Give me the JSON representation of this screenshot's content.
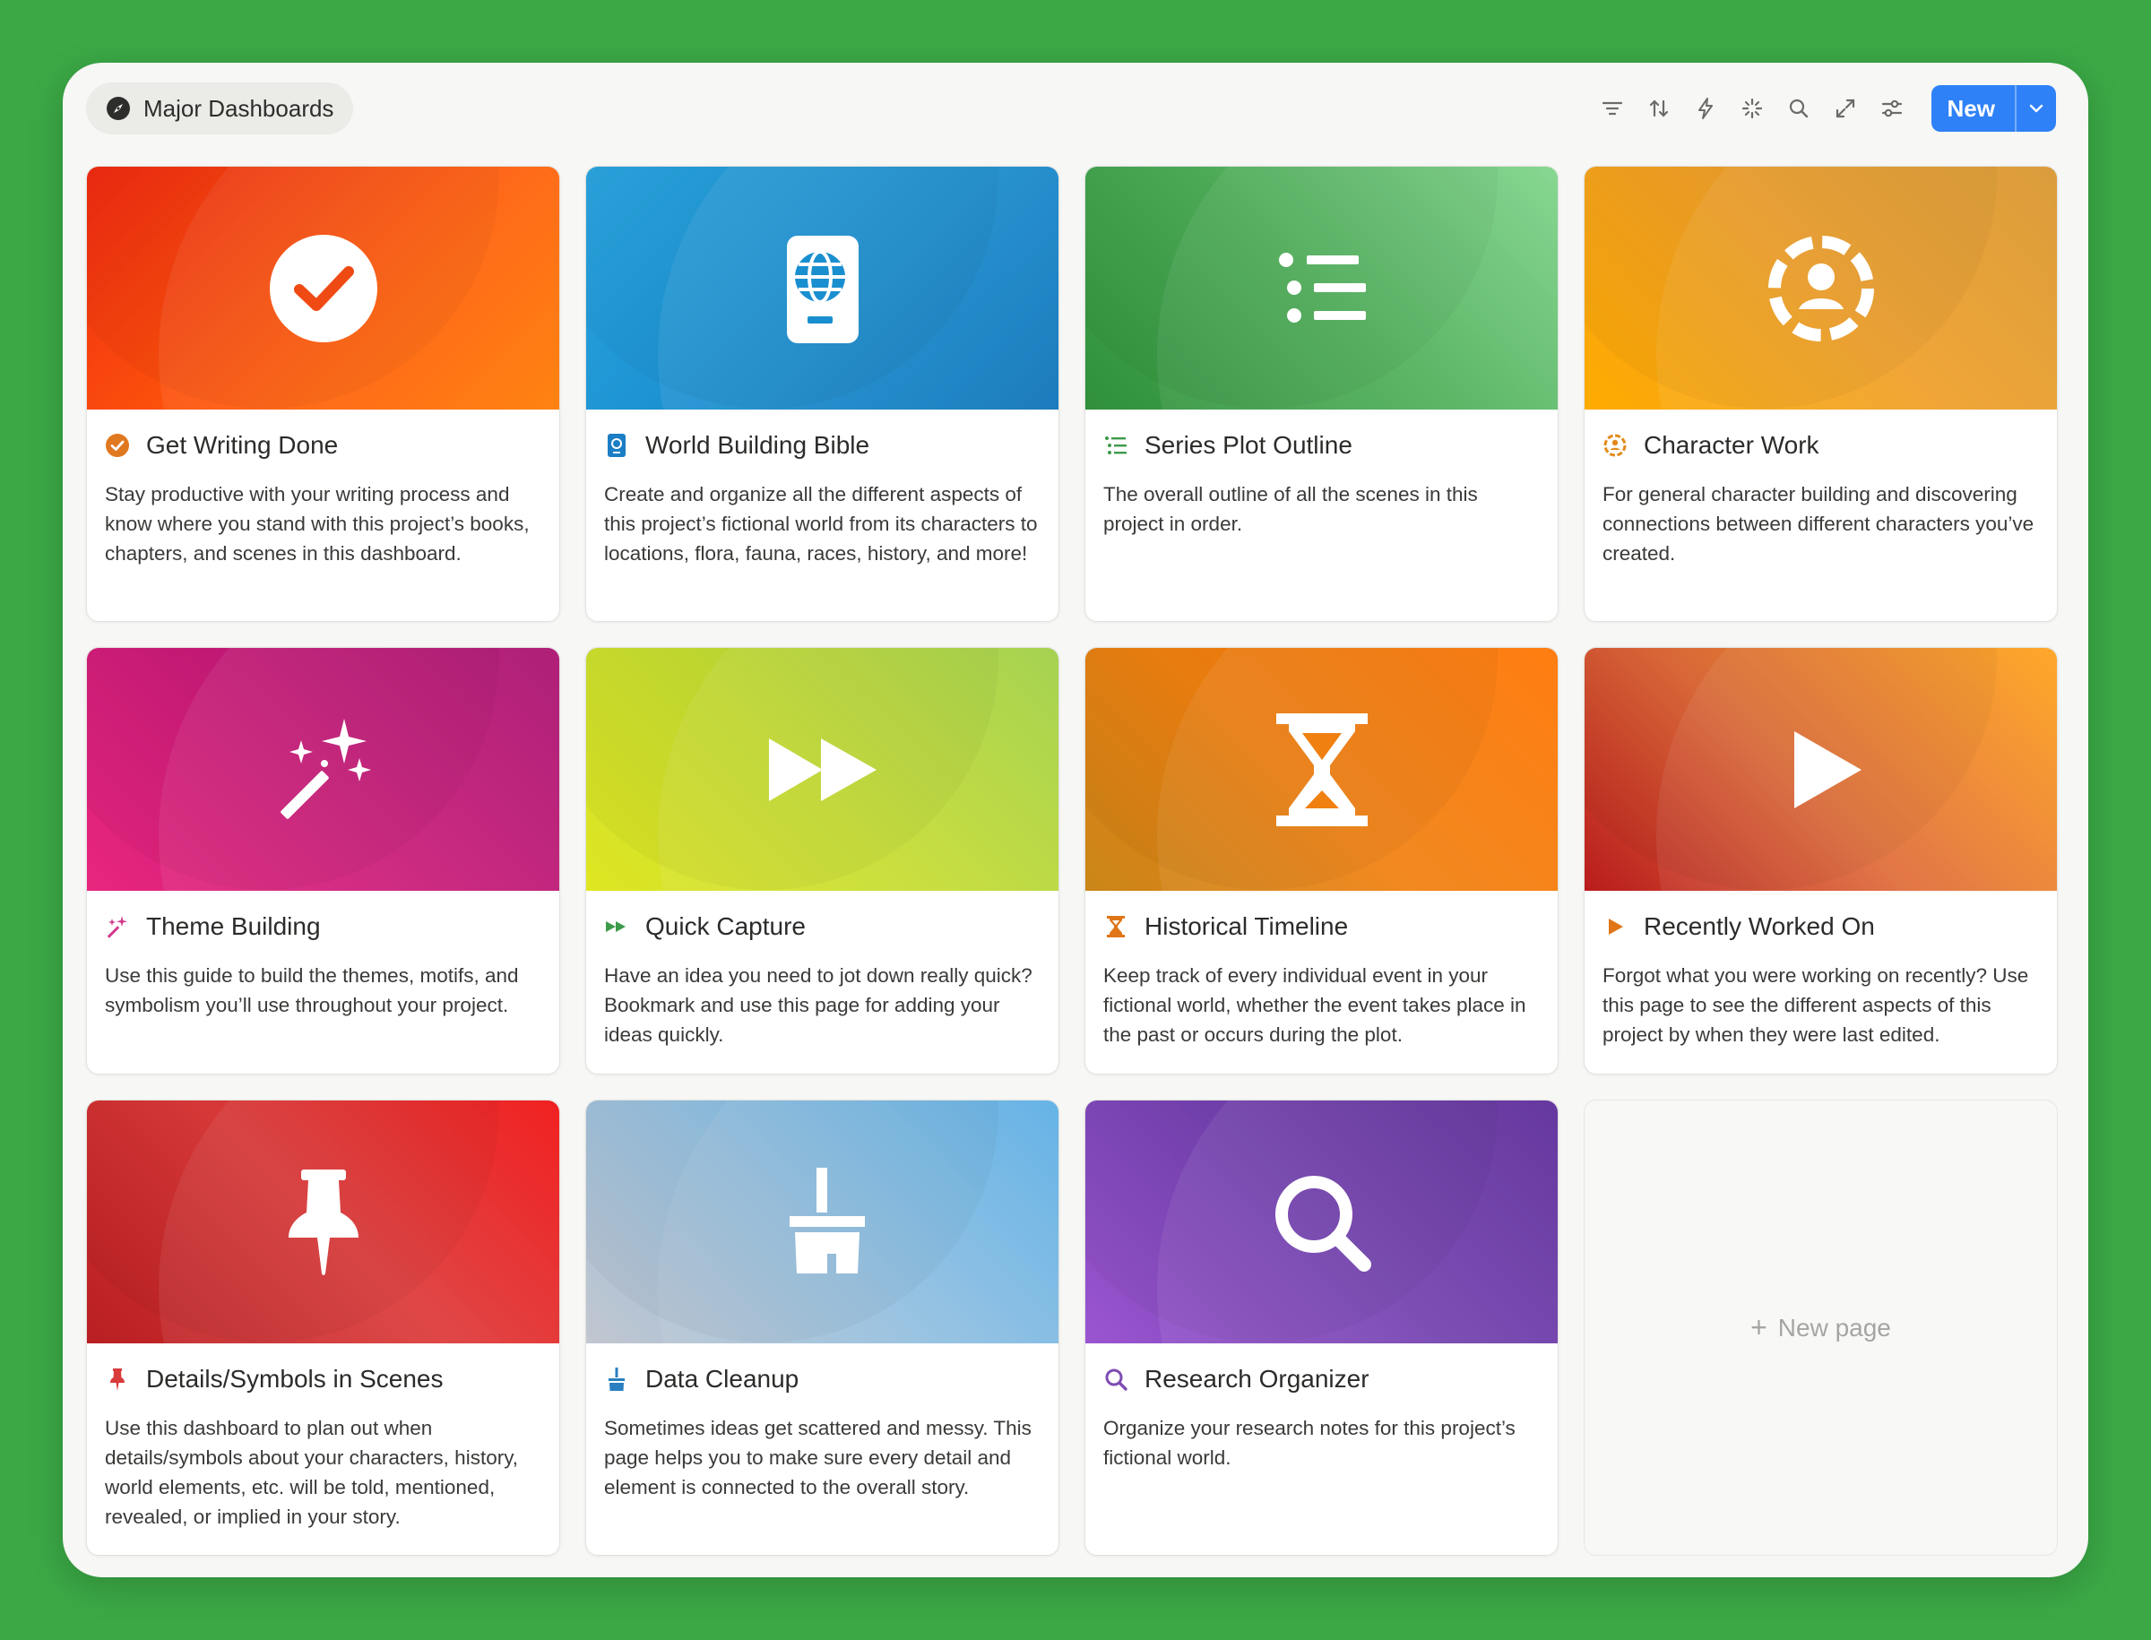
{
  "header": {
    "view_title": "Major Dashboards",
    "view_icon": "compass-icon",
    "tools": [
      "filter-icon",
      "sort-icon",
      "automation-icon",
      "ai-sparkle-icon",
      "search-icon",
      "expand-icon",
      "settings-sliders-icon"
    ],
    "new_label": "New"
  },
  "cards": [
    {
      "title": "Get Writing Done",
      "icon": "check-circle-icon",
      "accent": "#e0781f",
      "desc": "Stay productive with your writing process and know where you stand with this project’s books, chapters, and scenes in this dashboard."
    },
    {
      "title": "World Building Bible",
      "icon": "passport-globe-icon",
      "accent": "#1b7ec4",
      "desc": "Create and organize all the different aspects of this project’s fictional world from its characters to locations, flora, fauna, races, history, and more!"
    },
    {
      "title": "Series Plot Outline",
      "icon": "bulleted-list-icon",
      "accent": "#3c9b4a",
      "desc": "The overall outline of all the scenes in this project in order."
    },
    {
      "title": "Character Work",
      "icon": "person-circle-icon",
      "accent": "#e28b1c",
      "desc": "For general character building and discovering connections between different characters you’ve created."
    },
    {
      "title": "Theme Building",
      "icon": "magic-wand-icon",
      "accent": "#d1398b",
      "desc": "Use this guide to build the themes, motifs, and symbolism you’ll use throughout your project."
    },
    {
      "title": "Quick Capture",
      "icon": "fast-forward-icon",
      "accent": "#3c9b4a",
      "desc": "Have an idea you need to jot down really quick? Bookmark and use this page for adding your ideas quickly."
    },
    {
      "title": "Historical Timeline",
      "icon": "hourglass-icon",
      "accent": "#e07518",
      "desc": "Keep track of every individual event in your fictional world, whether the event takes place in the past or occurs during the plot."
    },
    {
      "title": "Recently Worked On",
      "icon": "play-icon",
      "accent": "#e07518",
      "desc": "Forgot what you were working on recently? Use this page to see the different aspects of this project by when they were last edited."
    },
    {
      "title": "Details/Symbols in Scenes",
      "icon": "pushpin-icon",
      "accent": "#d93b3b",
      "desc": "Use this dashboard to plan out when details/symbols about your characters, history, world elements, etc. will be told, mentioned, revealed, or implied in your story."
    },
    {
      "title": "Data Cleanup",
      "icon": "broom-icon",
      "accent": "#2a7fc0",
      "desc": "Sometimes ideas get scattered and messy. This page helps you to make sure every detail and element is connected to the overall story."
    },
    {
      "title": "Research Organizer",
      "icon": "magnifier-icon",
      "accent": "#7d4cb3",
      "desc": "Organize your research notes for this project’s fictional world."
    }
  ],
  "new_page": {
    "label": "New page"
  }
}
